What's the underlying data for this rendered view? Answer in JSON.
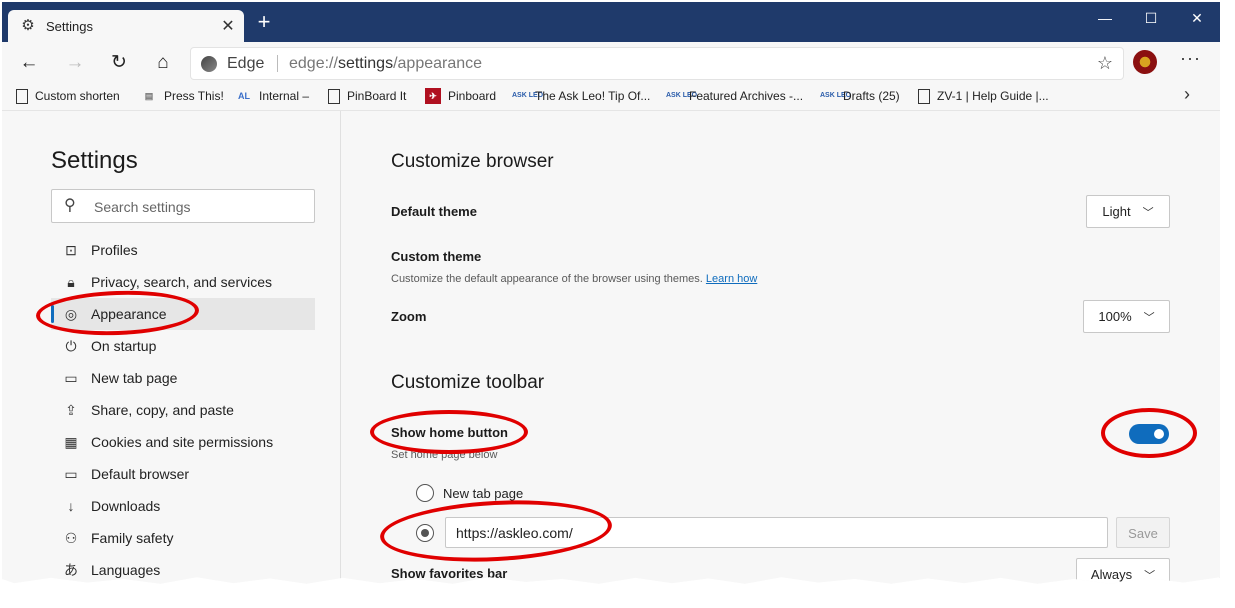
{
  "tab": {
    "icon": "gear-icon",
    "title": "Settings",
    "close": "✕"
  },
  "window_controls": {
    "minimize": "—",
    "maximize": "☐",
    "close": "✕"
  },
  "address": {
    "site_name": "Edge",
    "url_scheme": "edge://",
    "url_host": "settings",
    "url_path": "/appearance"
  },
  "favorites": [
    {
      "icon": "page-icon",
      "label": "Custom shorten"
    },
    {
      "icon": "press-this-icon",
      "label": "Press This!"
    },
    {
      "icon": "al-biz-icon",
      "label": "Internal –"
    },
    {
      "icon": "page-icon",
      "label": "PinBoard It"
    },
    {
      "icon": "pinboard-icon",
      "label": "Pinboard"
    },
    {
      "icon": "ask-leo-icon",
      "label": "The Ask Leo! Tip Of..."
    },
    {
      "icon": "ask-leo-icon",
      "label": "Featured Archives -..."
    },
    {
      "icon": "ask-leo-icon",
      "label": "Drafts (25)"
    },
    {
      "icon": "page-icon",
      "label": "ZV-1 | Help Guide |..."
    }
  ],
  "sidebar": {
    "title": "Settings",
    "search_placeholder": "Search settings",
    "items": [
      {
        "icon": "profile-icon",
        "label": "Profiles"
      },
      {
        "icon": "lock-icon",
        "label": "Privacy, search, and services"
      },
      {
        "icon": "palette-icon",
        "label": "Appearance",
        "active": true
      },
      {
        "icon": "power-icon",
        "label": "On startup"
      },
      {
        "icon": "new-tab-icon",
        "label": "New tab page"
      },
      {
        "icon": "share-icon",
        "label": "Share, copy, and paste"
      },
      {
        "icon": "cookies-icon",
        "label": "Cookies and site permissions"
      },
      {
        "icon": "browser-icon",
        "label": "Default browser"
      },
      {
        "icon": "download-icon",
        "label": "Downloads"
      },
      {
        "icon": "family-icon",
        "label": "Family safety"
      },
      {
        "icon": "languages-icon",
        "label": "Languages"
      }
    ]
  },
  "main": {
    "customize_browser": "Customize browser",
    "default_theme_label": "Default theme",
    "default_theme_value": "Light",
    "custom_theme_label": "Custom theme",
    "custom_theme_desc": "Customize the default appearance of the browser using themes.",
    "learn_how": "Learn how",
    "zoom_label": "Zoom",
    "zoom_value": "100%",
    "customize_toolbar": "Customize toolbar",
    "show_home_label": "Show home button",
    "show_home_desc": "Set home page below",
    "show_home_enabled": true,
    "new_tab_option": "New tab page",
    "home_url": "https://askleo.com/",
    "save_label": "Save",
    "favorites_bar_label": "Show favorites bar",
    "favorites_bar_value": "Always"
  },
  "colors": {
    "accent": "#0f6cbd",
    "annotation": "#e00000",
    "titlebar": "#1f3a6b"
  }
}
